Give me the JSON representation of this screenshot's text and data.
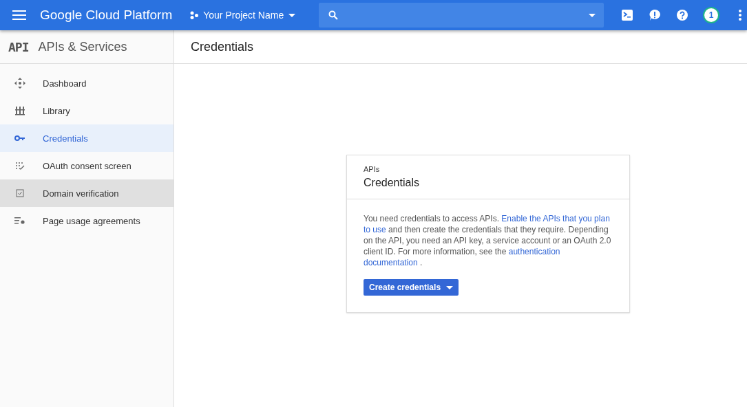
{
  "topbar": {
    "product": "Google Cloud Platform",
    "project": "Your Project Name",
    "avatar": "1"
  },
  "sidebar": {
    "logo": "API",
    "title": "APIs & Services",
    "items": [
      {
        "label": "Dashboard",
        "selected": false,
        "highlighted": false
      },
      {
        "label": "Library",
        "selected": false,
        "highlighted": false
      },
      {
        "label": "Credentials",
        "selected": true,
        "highlighted": false
      },
      {
        "label": "OAuth consent screen",
        "selected": false,
        "highlighted": false
      },
      {
        "label": "Domain verification",
        "selected": false,
        "highlighted": true
      },
      {
        "label": "Page usage agreements",
        "selected": false,
        "highlighted": false
      }
    ]
  },
  "page": {
    "title": "Credentials"
  },
  "card": {
    "overline": "APIs",
    "title": "Credentials",
    "paragraph": [
      {
        "kind": "text",
        "text": "You need credentials to access APIs. "
      },
      {
        "kind": "link",
        "text": "Enable the APIs that you plan"
      },
      {
        "kind": "link",
        "text": "to use"
      },
      {
        "kind": "text",
        "text": " and then create the credentials that they require. Depending on the API, you need an API key, a service account or an OAuth 2.0 client ID. For more information, see the "
      },
      {
        "kind": "link",
        "text": "authentication"
      },
      {
        "kind": "link",
        "text": "documentation"
      },
      {
        "kind": "text",
        "text": " ."
      }
    ],
    "button": "Create credentials"
  }
}
